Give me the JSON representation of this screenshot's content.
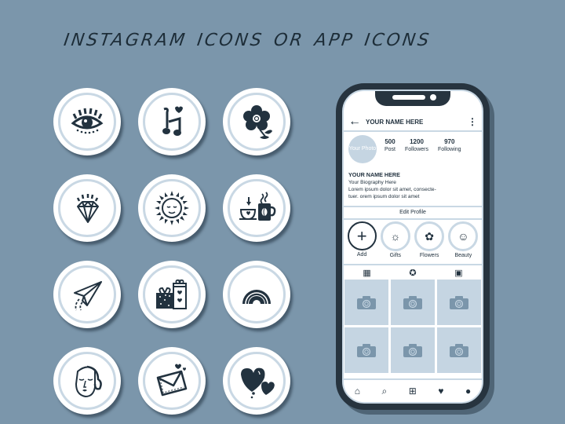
{
  "title": "instagram icons or app icons",
  "icons": [
    {
      "name": "eye"
    },
    {
      "name": "music-notes"
    },
    {
      "name": "flower"
    },
    {
      "name": "diamond"
    },
    {
      "name": "sun"
    },
    {
      "name": "coffee"
    },
    {
      "name": "paper-plane"
    },
    {
      "name": "gifts"
    },
    {
      "name": "rainbow"
    },
    {
      "name": "woman-face"
    },
    {
      "name": "envelope"
    },
    {
      "name": "hearts"
    }
  ],
  "phone": {
    "back_icon": "←",
    "username": "YOUR NAME HERE",
    "menu_icon": "⋮",
    "avatar_text": "Your Photo",
    "stats": [
      {
        "value": "500",
        "label": "Post"
      },
      {
        "value": "1200",
        "label": "Followers"
      },
      {
        "value": "970",
        "label": "Following"
      }
    ],
    "bio_name": "YOUR NAME HERE",
    "bio_line1": "Your Biography Here",
    "bio_line2": "Lorem ipsum dolor sit amet, consecte-",
    "bio_line3": "tuer. orem ipsum dolor sit amet",
    "edit_profile": "Edit Profile",
    "highlights": [
      {
        "label": "Add",
        "icon": "+"
      },
      {
        "label": "Gifts",
        "icon": "☼"
      },
      {
        "label": "Flowers",
        "icon": "✿"
      },
      {
        "label": "Beauty",
        "icon": "☺"
      }
    ],
    "tabs": [
      "▦",
      "✪",
      "▣"
    ],
    "posts": 6,
    "nav": [
      "⌂",
      "⌕",
      "⊞",
      "♥",
      "●"
    ]
  },
  "colors": {
    "background": "#7b96ab",
    "ink": "#22323f",
    "accent_light": "#c9d8e4",
    "placeholder": "#c5d5e2"
  }
}
